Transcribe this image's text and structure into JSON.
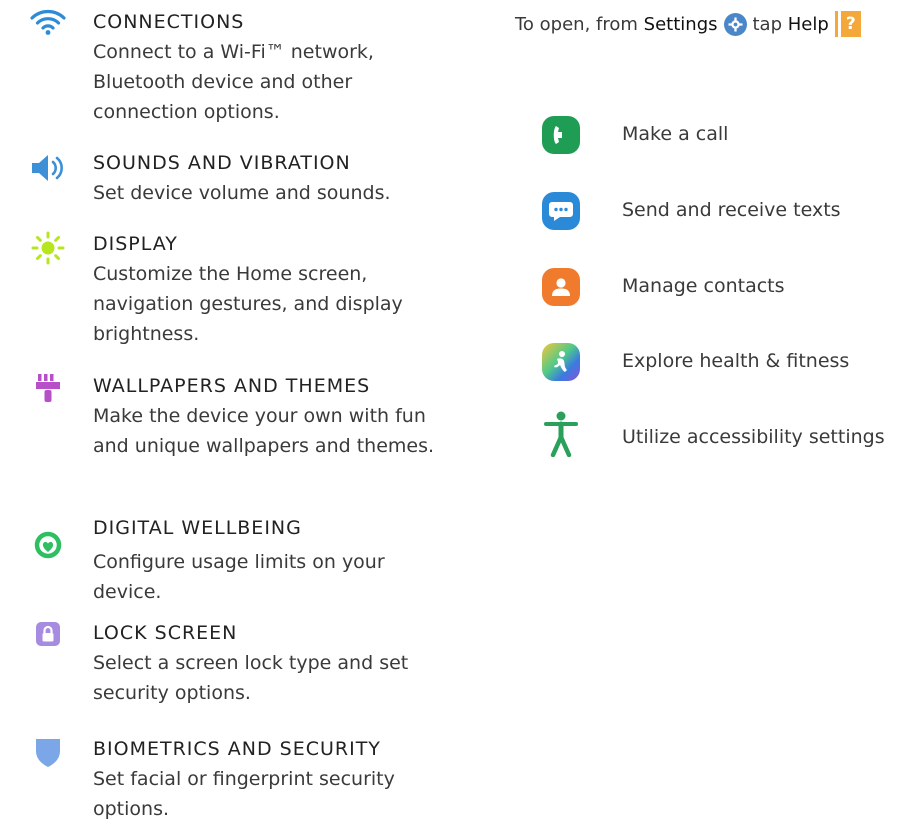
{
  "settings": [
    {
      "icon": "wifi-icon",
      "title": "CONNECTIONS",
      "desc": "Connect to a Wi-Fi™ network, Bluetooth device and other connection options."
    },
    {
      "icon": "speaker-icon",
      "title": "SOUNDS AND VIBRATION",
      "desc": "Set device volume and sounds."
    },
    {
      "icon": "sun-icon",
      "title": "DISPLAY",
      "desc": "Customize the Home screen, navigation gestures, and display brightness."
    },
    {
      "icon": "paintbrush-icon",
      "title": "WALLPAPERS AND THEMES",
      "desc": "Make the device your own with fun and unique wallpapers and themes."
    },
    {
      "icon": "wellbeing-icon",
      "title": "DIGITAL WELLBEING",
      "desc": "Configure usage limits on your device."
    },
    {
      "icon": "lock-icon",
      "title": "LOCK SCREEN",
      "desc": "Select a screen lock type and set security options."
    },
    {
      "icon": "shield-icon",
      "title": "BIOMETRICS AND SECURITY",
      "desc": "Set facial or fingerprint security options."
    }
  ],
  "intro": {
    "prefix": "To open, from",
    "settings_word": "Settings",
    "middle": "tap",
    "help_word": "Help",
    "help_glyph": "?"
  },
  "tasks": [
    {
      "icon": "phone-icon",
      "label": "Make a call",
      "color": "#1f9d55"
    },
    {
      "icon": "message-icon",
      "label": "Send and receive texts",
      "color": "#2a8ad8"
    },
    {
      "icon": "contacts-icon",
      "label": "Manage contacts",
      "color": "#f07b2c"
    },
    {
      "icon": "health-icon",
      "label": "Explore health & fitness",
      "color": "#6a5cd6"
    },
    {
      "icon": "accessibility-icon",
      "label": "Utilize accessibility settings",
      "color": "#2aa05a"
    }
  ]
}
